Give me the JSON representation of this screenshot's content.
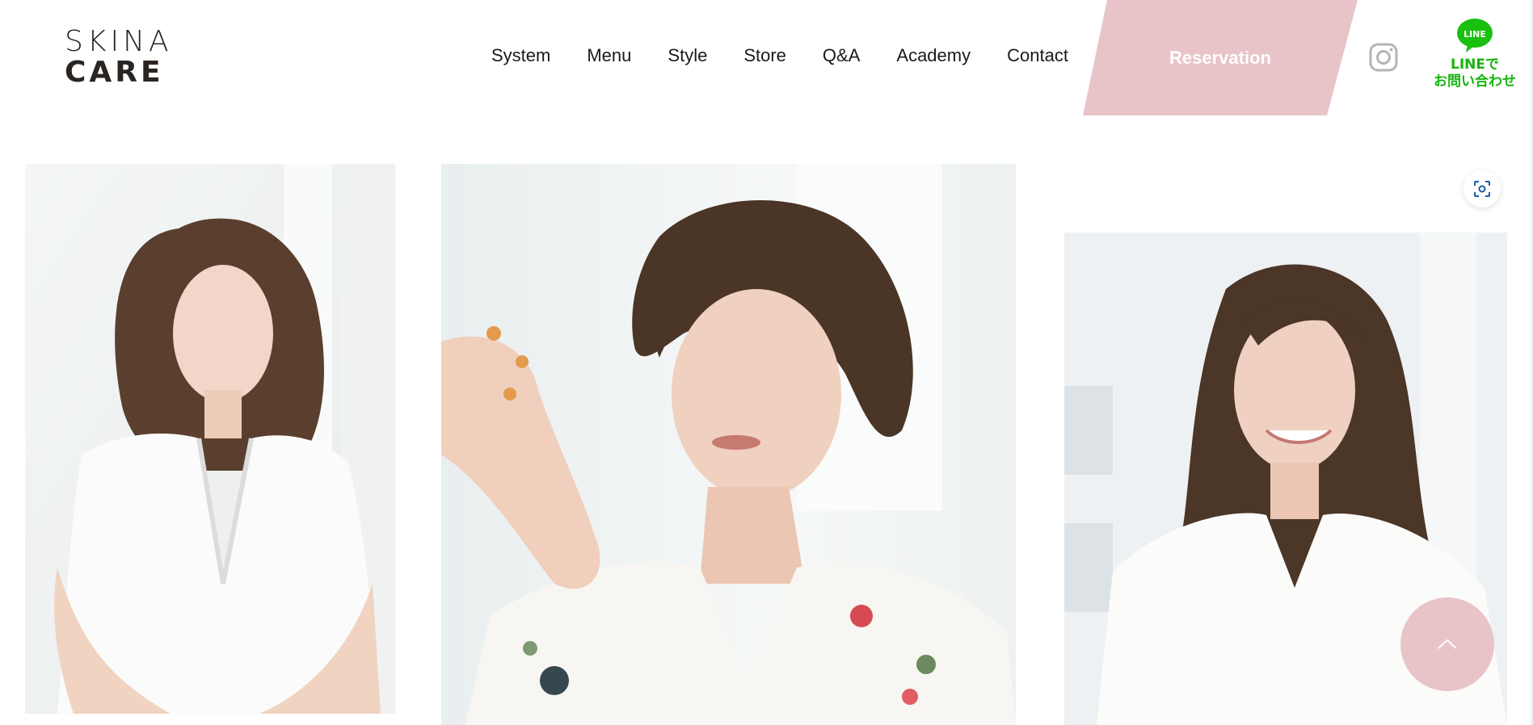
{
  "brand": {
    "logo_top": "SKINA",
    "logo_bottom": "CARE"
  },
  "nav": {
    "items": [
      {
        "label": "System"
      },
      {
        "label": "Menu"
      },
      {
        "label": "Style"
      },
      {
        "label": "Store"
      },
      {
        "label": "Q&A"
      },
      {
        "label": "Academy"
      },
      {
        "label": "Contact"
      }
    ]
  },
  "reservation": {
    "label": "Reservation",
    "color": "#e8c4c8"
  },
  "social": {
    "instagram_icon": "instagram-icon",
    "line_badge": "LINE",
    "line_text_1": "LINEで",
    "line_text_2": "お問い合わせ",
    "line_color": "#15b40d"
  },
  "gallery": {
    "photos": [
      {
        "name": "model-bob-hair",
        "icon": "photo"
      },
      {
        "name": "model-short-hair",
        "icon": "photo"
      },
      {
        "name": "model-long-wavy-hair",
        "icon": "photo"
      }
    ]
  },
  "controls": {
    "scan_icon": "scan-icon",
    "back_to_top_icon": "chevron-up-icon",
    "accent": "#e8c4c8"
  }
}
